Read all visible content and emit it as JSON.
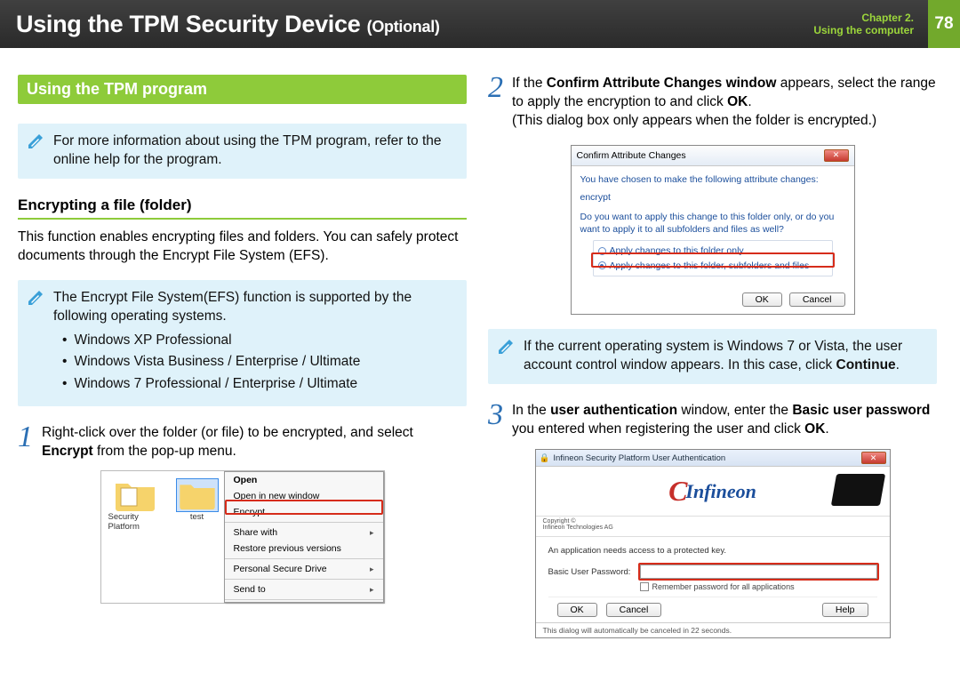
{
  "header": {
    "title_main": "Using the TPM Security Device",
    "title_suffix": "(Optional)",
    "chapter_line1": "Chapter 2.",
    "chapter_line2": "Using the computer",
    "page_number": "78"
  },
  "left": {
    "section_title": "Using the TPM program",
    "note1": "For more information about using the TPM program, refer to the online help for the program.",
    "sub_title": "Encrypting a file (folder)",
    "para1": "This function enables encrypting files and folders. You can safely protect documents through the Encrypt File System (EFS).",
    "note2_intro": "The Encrypt File System(EFS) function is supported by the following operating systems.",
    "os_items": [
      "Windows XP Professional",
      "Windows Vista Business / Enterprise / Ultimate",
      "Windows 7 Professional / Enterprise / Ultimate"
    ],
    "step1_num": "1",
    "step1_pre": "Right-click over the folder (or file) to be encrypted, and select ",
    "step1_bold": "Encrypt",
    "step1_post": " from the pop-up menu.",
    "folder_labels": {
      "a": "Security Platform",
      "b": "test"
    },
    "context_menu": {
      "open": "Open",
      "open_new": "Open in new window",
      "encrypt": "Encrypt",
      "share_with": "Share with",
      "restore": "Restore previous versions",
      "psd": "Personal Secure Drive",
      "send_to": "Send to"
    }
  },
  "right": {
    "step2_num": "2",
    "s2_a": "If the ",
    "s2_b": "Confirm Attribute Changes window",
    "s2_c": " appears, select the range to apply the encryption to and click ",
    "s2_d": "OK",
    "s2_e": ".",
    "s2_line2": "(This dialog box only appears when the folder is encrypted.)",
    "dlg": {
      "title": "Confirm Attribute Changes",
      "line1": "You have chosen to make the following attribute changes:",
      "attr": "encrypt",
      "line2": "Do you want to apply this change to this folder only, or do you want to apply it to all subfolders and files as well?",
      "opt1": "Apply changes to this folder only",
      "opt2": "Apply changes to this folder, subfolders and files",
      "ok": "OK",
      "cancel": "Cancel"
    },
    "note3_a": "If the current operating system is Windows 7 or Vista, the user account control window appears. In this case, click ",
    "note3_b": "Continue",
    "note3_c": ".",
    "step3_num": "3",
    "s3_a": "In the ",
    "s3_b": "user authentication",
    "s3_c": " window, enter the ",
    "s3_d": "Basic user password",
    "s3_e": " you entered when registering the user and click ",
    "s3_f": "OK",
    "s3_g": ".",
    "auth": {
      "win_title": "Infineon Security Platform User Authentication",
      "brand": "Infineon",
      "copy1": "Copyright ©",
      "copy2": "Infineon Technologies AG",
      "msg": "An application needs access to a protected key.",
      "label": "Basic User Password:",
      "remember": "Remember password for all applications",
      "ok": "OK",
      "cancel": "Cancel",
      "help": "Help",
      "footer": "This dialog will automatically be canceled in 22 seconds."
    }
  }
}
